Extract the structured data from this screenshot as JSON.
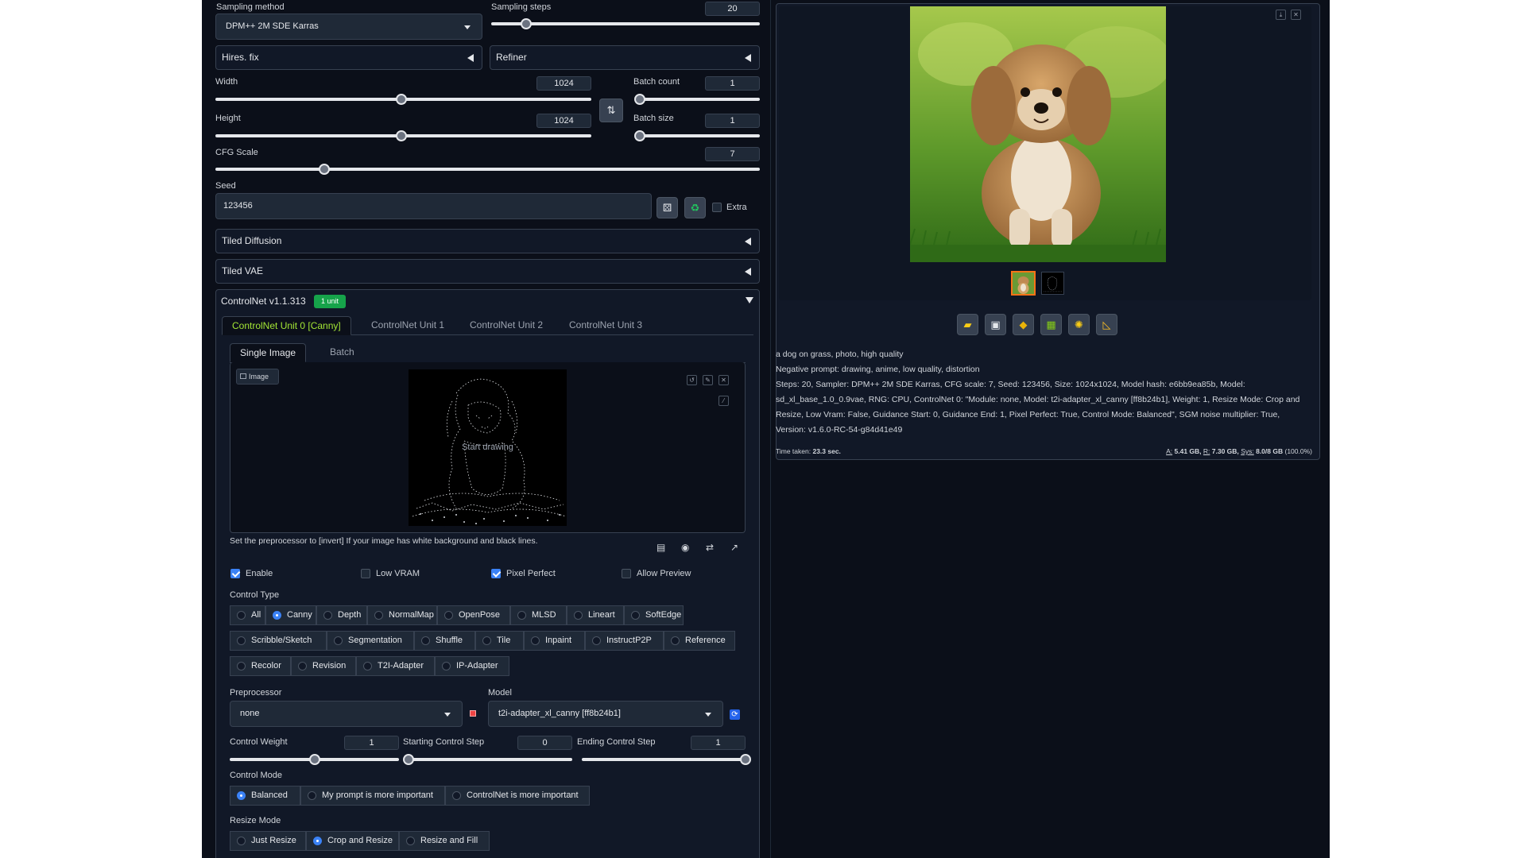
{
  "sampling": {
    "method_label": "Sampling method",
    "method_value": "DPM++ 2M SDE Karras",
    "steps_label": "Sampling steps",
    "steps_value": "20",
    "steps_fraction": 0.13
  },
  "accordions": {
    "hires_fix": "Hires. fix",
    "refiner": "Refiner",
    "tiled_diffusion": "Tiled Diffusion",
    "tiled_vae": "Tiled VAE"
  },
  "dims": {
    "width_label": "Width",
    "width_value": "1024",
    "height_label": "Height",
    "height_value": "1024",
    "batch_count_label": "Batch count",
    "batch_count_value": "1",
    "batch_size_label": "Batch size",
    "batch_size_value": "1",
    "swap_icon": "swap-arrows-icon"
  },
  "cfg": {
    "label": "CFG Scale",
    "value": "7",
    "fraction": 0.2
  },
  "seed": {
    "label": "Seed",
    "value": "123456",
    "dice_icon": "dice-icon",
    "recycle_icon": "recycle-icon",
    "extra_label": "Extra"
  },
  "controlnet": {
    "title": "ControlNet v1.1.313",
    "badge": "1 unit",
    "badge_color": "#16a34a",
    "unit_tabs": [
      "ControlNet Unit 0 [Canny]",
      "ControlNet Unit 1",
      "ControlNet Unit 2",
      "ControlNet Unit 3"
    ],
    "image_tabs": [
      "Single Image",
      "Batch"
    ],
    "image_label": "Image",
    "canvas_placeholder": "Start drawing",
    "hint": "Set the preprocessor to [invert] If your image has white background and black lines.",
    "checks": {
      "enable": "Enable",
      "low_vram": "Low VRAM",
      "pixel_perfect": "Pixel Perfect",
      "allow_preview": "Allow Preview"
    },
    "control_type_label": "Control Type",
    "control_types_row1": [
      "All",
      "Canny",
      "Depth",
      "NormalMap",
      "OpenPose",
      "MLSD",
      "Lineart",
      "SoftEdge"
    ],
    "control_types_row2": [
      "Scribble/Sketch",
      "Segmentation",
      "Shuffle",
      "Tile",
      "Inpaint",
      "InstructP2P",
      "Reference"
    ],
    "control_types_row3": [
      "Recolor",
      "Revision",
      "T2I-Adapter",
      "IP-Adapter"
    ],
    "preprocessor_label": "Preprocessor",
    "preprocessor_value": "none",
    "model_label": "Model",
    "model_value": "t2i-adapter_xl_canny [ff8b24b1]",
    "weight_label": "Control Weight",
    "weight_value": "1",
    "weight_fraction": 0.5,
    "start_label": "Starting Control Step",
    "start_value": "0",
    "start_fraction": 0,
    "end_label": "Ending Control Step",
    "end_value": "1",
    "end_fraction": 1,
    "control_mode_label": "Control Mode",
    "control_modes": [
      "Balanced",
      "My prompt is more important",
      "ControlNet is more important"
    ],
    "resize_mode_label": "Resize Mode",
    "resize_modes": [
      "Just Resize",
      "Crop and Resize",
      "Resize and Fill"
    ]
  },
  "output": {
    "prompt": "a dog on grass, photo, high quality",
    "negative": "Negative prompt: drawing, anime, low quality, distortion",
    "params_line1": "Steps: 20, Sampler: DPM++ 2M SDE Karras, CFG scale: 7, Seed: 123456, Size: 1024x1024, Model hash: e6bb9ea85b, Model:",
    "params_line2": "sd_xl_base_1.0_0.9vae, RNG: CPU, ControlNet 0: \"Module: none, Model: t2i-adapter_xl_canny [ff8b24b1], Weight: 1, Resize Mode: Crop and",
    "params_line3": "Resize, Low Vram: False, Guidance Start: 0, Guidance End: 1, Pixel Perfect: True, Control Mode: Balanced\", SGM noise multiplier: True,",
    "params_line4": "Version: v1.6.0-RC-54-g84d41e49",
    "time_label": "Time taken:",
    "time_value": "23.3 sec.",
    "mem_a_label": "A:",
    "mem_a": "5.41 GB,",
    "mem_r_label": "R:",
    "mem_r": "7.30 GB,",
    "mem_sys_label": "Sys:",
    "mem_sys": "8.0/8 GB",
    "mem_pct": "(100.0%)",
    "tool_icons": [
      "folder-icon",
      "save-icon",
      "zip-icon",
      "send-to-img2img-icon",
      "send-to-inpaint-icon",
      "send-to-extras-icon"
    ]
  }
}
